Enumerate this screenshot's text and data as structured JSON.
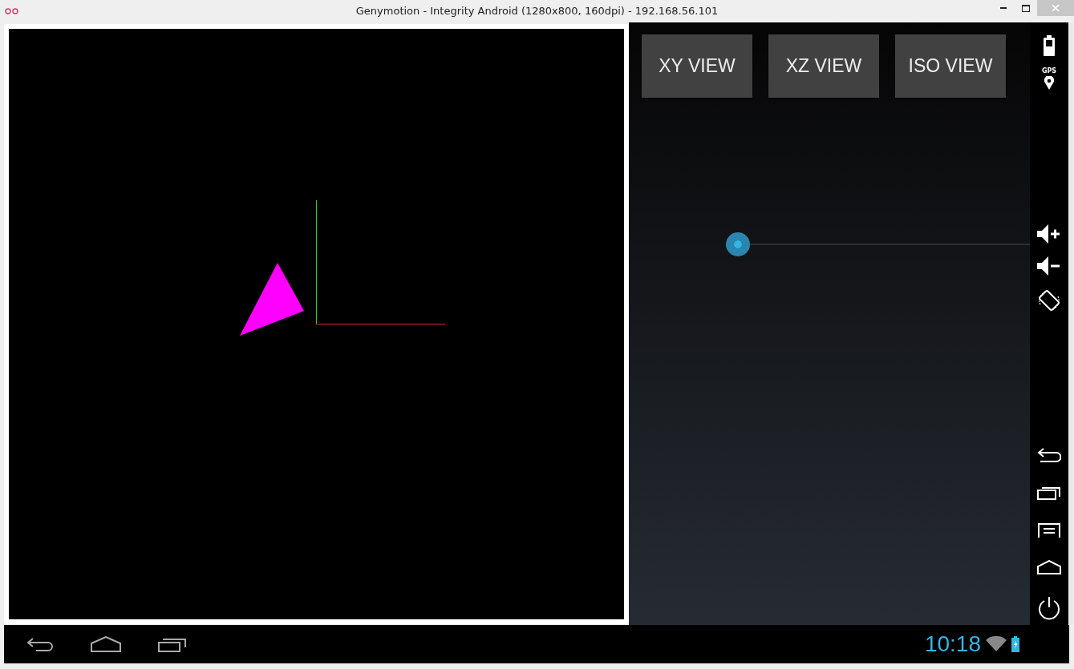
{
  "window": {
    "title": "Genymotion - Integrity Android (1280x800, 160dpi) - 192.168.56.101"
  },
  "view_buttons": [
    {
      "label": "XY VIEW"
    },
    {
      "label": "XZ VIEW"
    },
    {
      "label": "ISO VIEW"
    }
  ],
  "slider": {
    "level": 0
  },
  "side_toolbar": {
    "gps_label": "GPS"
  },
  "status_bar": {
    "time": "10:18"
  }
}
